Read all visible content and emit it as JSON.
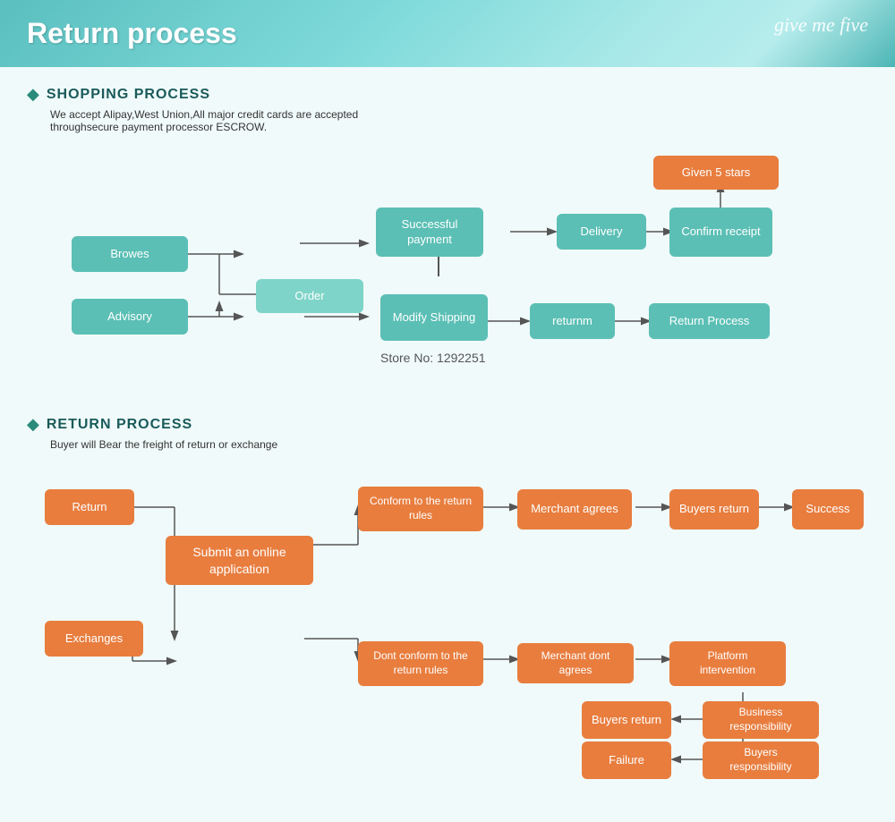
{
  "header": {
    "title": "Return process",
    "brand": "give me five"
  },
  "shopping": {
    "section_title": "SHOPPING PROCESS",
    "desc_line1": "We accept Alipay,West Union,All major credit cards are accepted",
    "desc_line2": "throughsecure payment processor ESCROW.",
    "store_no": "Store No: 1292251",
    "boxes": {
      "browes": "Browes",
      "order": "Order",
      "advisory": "Advisory",
      "modify_shipping": "Modify\nShipping",
      "successful_payment": "Successful\npayment",
      "delivery": "Delivery",
      "confirm_receipt": "Confirm\nreceipt",
      "given_5_stars": "Given 5 stars",
      "returnm": "returnm",
      "return_process": "Return Process"
    }
  },
  "return_process": {
    "section_title": "RETURN PROCESS",
    "desc": "Buyer will Bear the freight of return or exchange",
    "boxes": {
      "return": "Return",
      "exchanges": "Exchanges",
      "submit_online": "Submit an online\napplication",
      "conform_return_rules": "Conform to the\nreturn rules",
      "dont_conform_rules": "Dont conform to the\nreturn rules",
      "merchant_agrees": "Merchant\nagrees",
      "merchant_dont_agrees": "Merchant\ndont agrees",
      "buyers_return_1": "Buyers\nreturn",
      "success": "Success",
      "platform_intervention": "Platform\nintervention",
      "buyers_return_2": "Buyers\nreturn",
      "business_responsibility": "Business\nresponsibility",
      "failure": "Failure",
      "buyers_responsibility": "Buyers\nresponsibility"
    }
  }
}
